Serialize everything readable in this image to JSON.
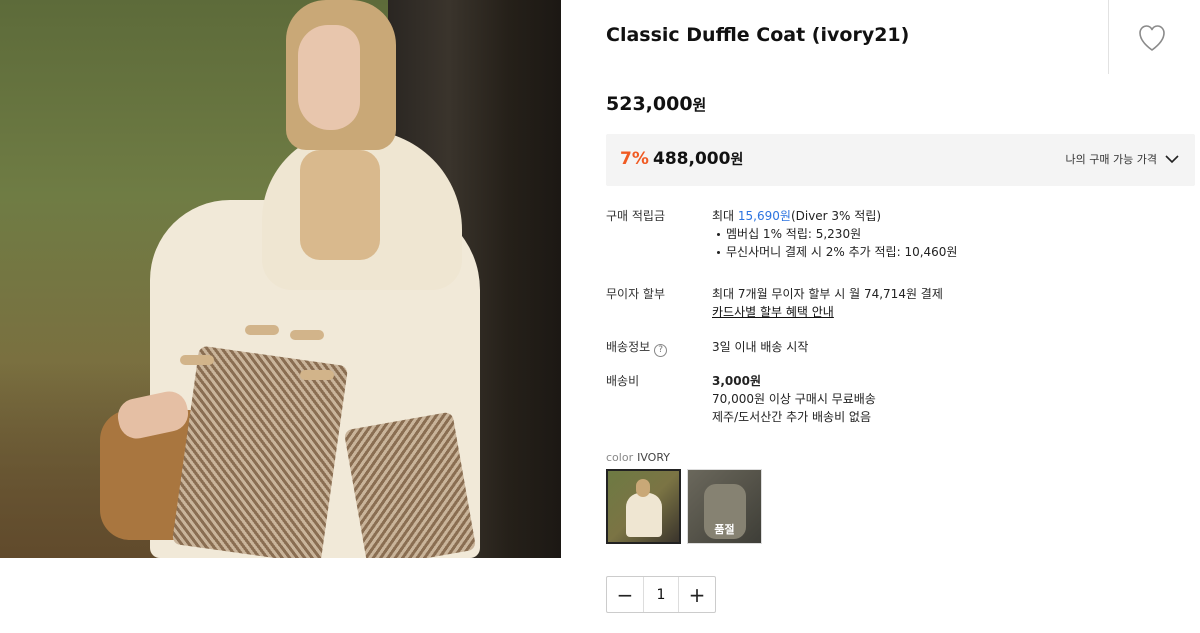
{
  "product": {
    "title": "Classic Duffle Coat (ivory21)",
    "price": "523,000",
    "currency": "원"
  },
  "sale": {
    "rate": "7%",
    "price": "488,000",
    "currency": "원",
    "my_price_label": "나의 구매 가능 가격"
  },
  "points": {
    "label": "구매 적립금",
    "prefix": "최대 ",
    "amount": "15,690원",
    "suffix": "(Diver 3% 적립)",
    "bullets": [
      "멤버십 1% 적립: 5,230원",
      "무신사머니 결제 시 2% 추가 적립: 10,460원"
    ]
  },
  "installment": {
    "label": "무이자 할부",
    "text": "최대 7개월 무이자 할부 시 월 74,714원 결제",
    "link": "카드사별 할부 혜택 안내"
  },
  "delivery_info": {
    "label": "배송정보",
    "help_icon": "?",
    "text": "3일 이내 배송 시작"
  },
  "shipping_fee": {
    "label": "배송비",
    "amount": "3,000원",
    "line1": "70,000원 이상 구매시 무료배송",
    "line2": "제주/도서산간 추가 배송비 없음"
  },
  "color": {
    "label": "color",
    "selected": "IVORY",
    "soldout_label": "품절"
  },
  "quantity": {
    "minus": "−",
    "value": "1",
    "plus": "+"
  },
  "icons": {
    "wishlist": "heart-icon",
    "chevron": "chevron-down-icon"
  },
  "colors": {
    "sale_rate": "#f05a22",
    "points_link": "#2c74e0"
  }
}
